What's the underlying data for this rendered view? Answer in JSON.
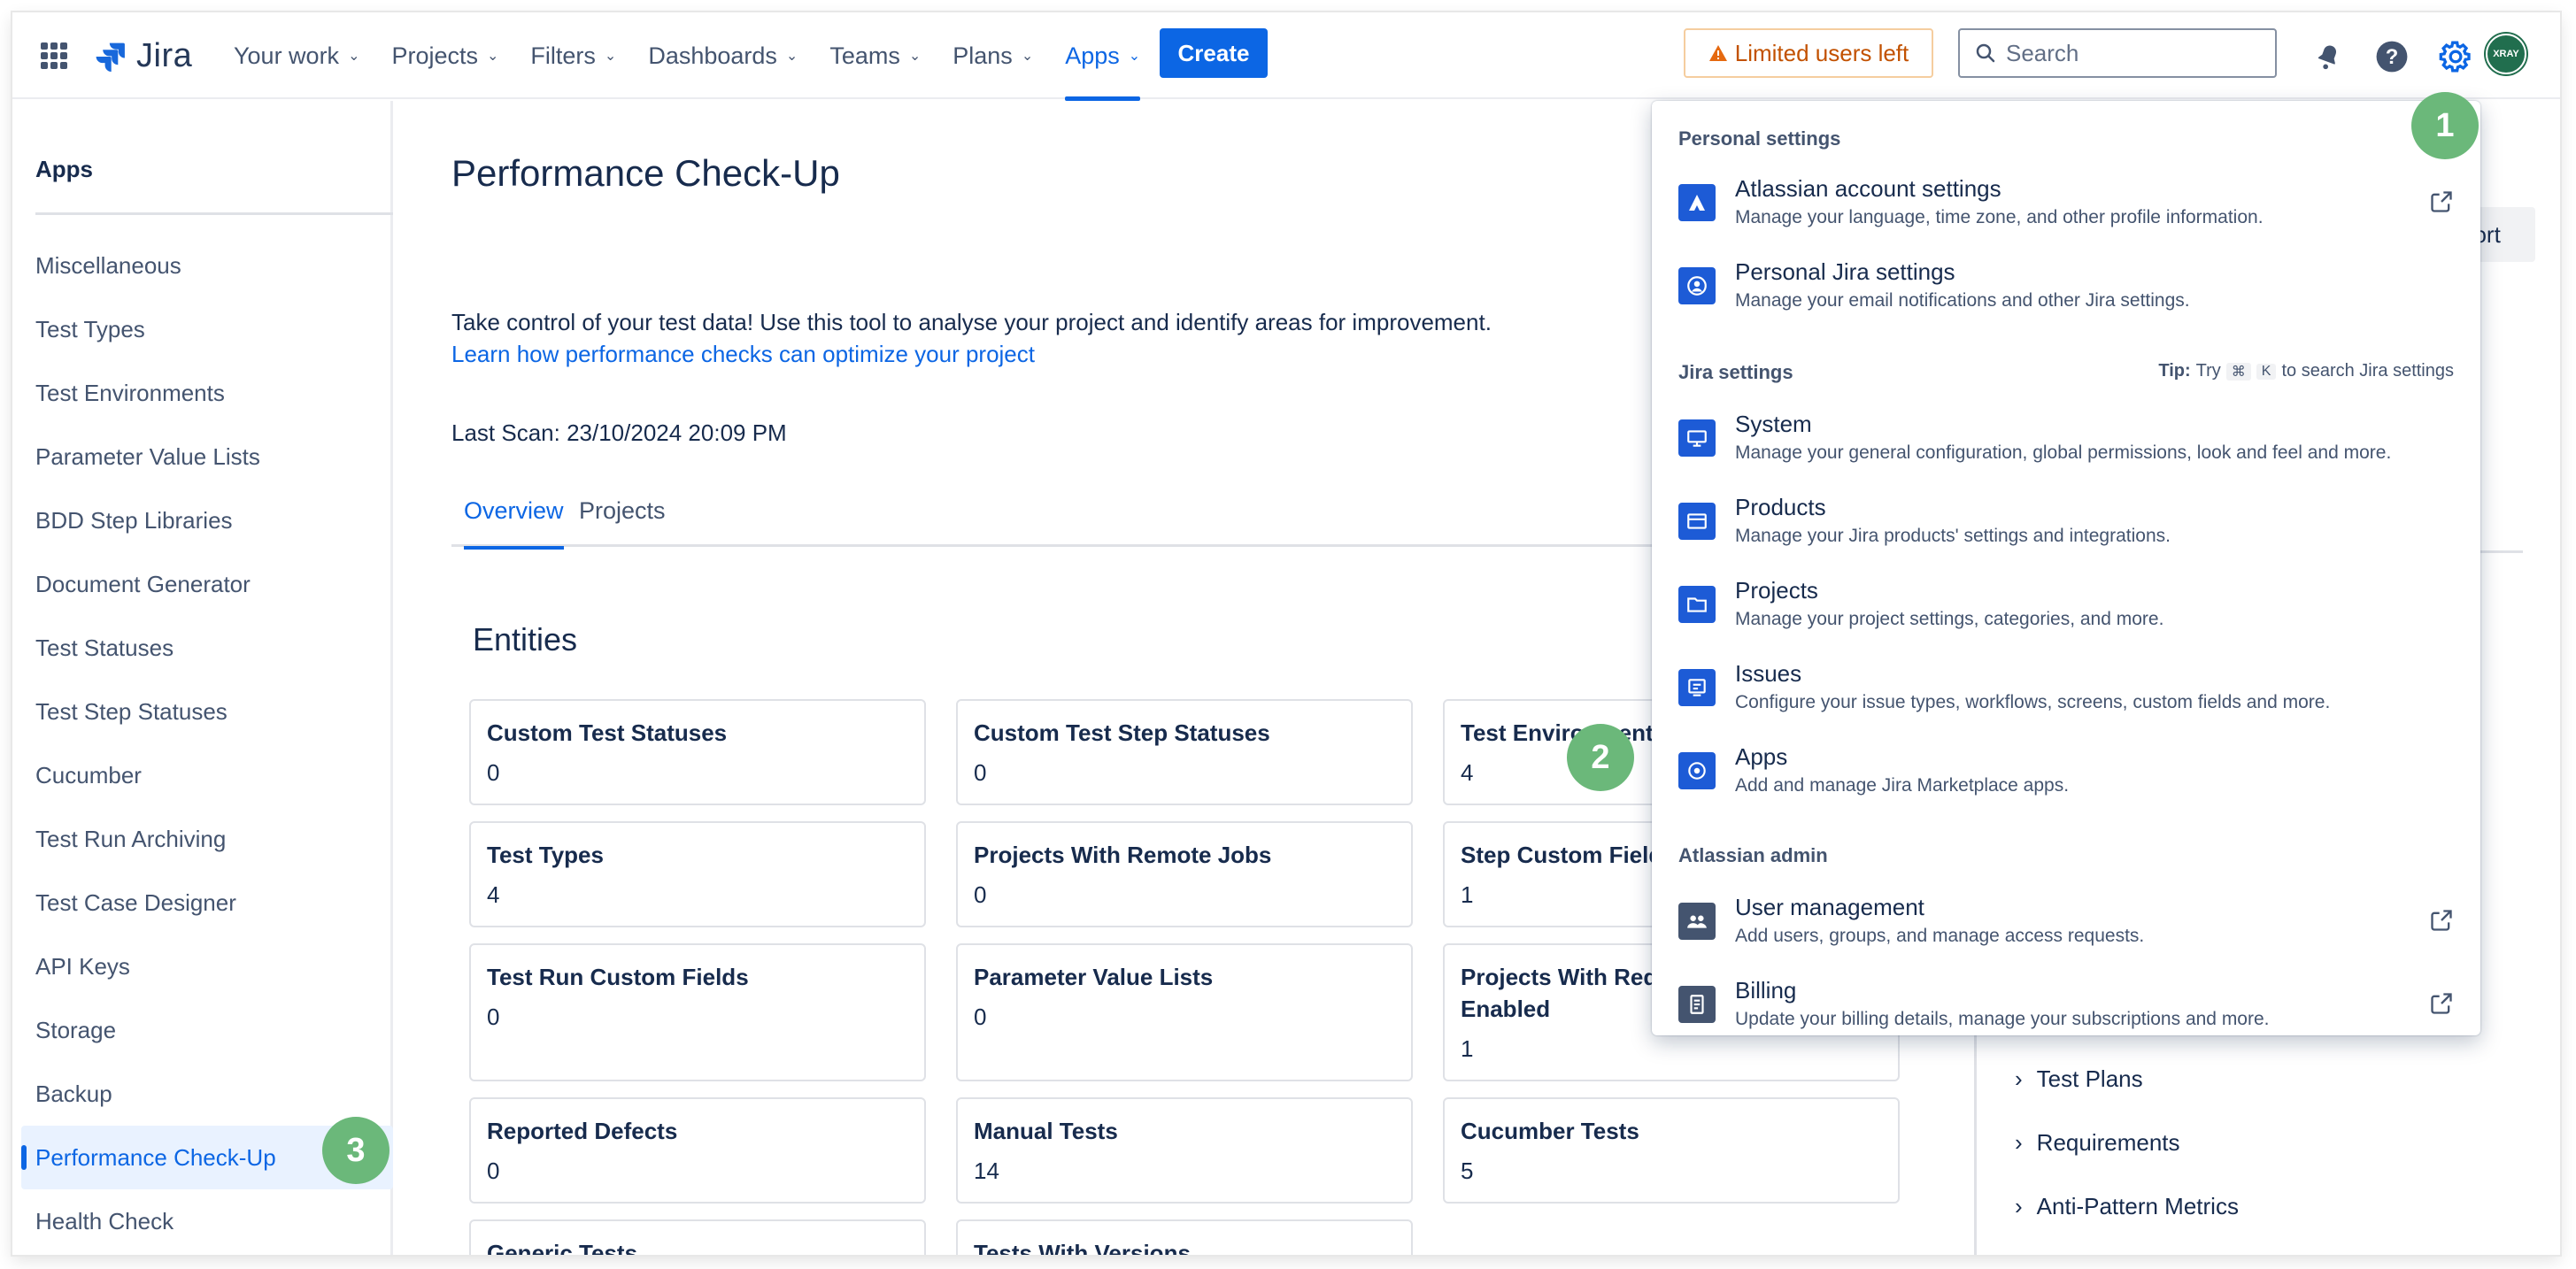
{
  "nav": {
    "logo": "Jira",
    "items": [
      {
        "label": "Your work"
      },
      {
        "label": "Projects"
      },
      {
        "label": "Filters"
      },
      {
        "label": "Dashboards"
      },
      {
        "label": "Teams"
      },
      {
        "label": "Plans"
      },
      {
        "label": "Apps",
        "active": true
      }
    ],
    "create": "Create",
    "limited_users": "Limited users left",
    "search_placeholder": "Search",
    "avatar": "XRAY"
  },
  "sidebar": {
    "title": "Apps",
    "items": [
      {
        "label": "Miscellaneous"
      },
      {
        "label": "Test Types"
      },
      {
        "label": "Test Environments"
      },
      {
        "label": "Parameter Value Lists"
      },
      {
        "label": "BDD Step Libraries"
      },
      {
        "label": "Document Generator"
      },
      {
        "label": "Test Statuses"
      },
      {
        "label": "Test Step Statuses"
      },
      {
        "label": "Cucumber"
      },
      {
        "label": "Test Run Archiving"
      },
      {
        "label": "Test Case Designer"
      },
      {
        "label": "API Keys"
      },
      {
        "label": "Storage"
      },
      {
        "label": "Backup"
      },
      {
        "label": "Performance Check-Up",
        "active": true
      },
      {
        "label": "Health Check"
      }
    ]
  },
  "main": {
    "title": "Performance Check-Up",
    "intro": "Take control of your test data! Use this tool to analyse your project and identify areas for improvement.",
    "learn_link": "Learn how performance checks can optimize your project",
    "last_scan": "Last Scan: 23/10/2024 20:09 PM",
    "tabs": [
      "Overview",
      "Projects"
    ],
    "section": "Entities",
    "cards": [
      {
        "title": "Custom Test Statuses",
        "value": "0"
      },
      {
        "title": "Custom Test Step Statuses",
        "value": "0"
      },
      {
        "title": "Test Environments",
        "value": "4"
      },
      {
        "title": "Test Types",
        "value": "4"
      },
      {
        "title": "Projects With Remote Jobs",
        "value": "0"
      },
      {
        "title": "Step Custom Fields",
        "value": "1"
      },
      {
        "title": "Test Run Custom Fields",
        "value": "0"
      },
      {
        "title": "Parameter Value Lists",
        "value": "0"
      },
      {
        "title": "Projects With Requirement Enabled",
        "value": "1"
      },
      {
        "title": "Reported Defects",
        "value": "0"
      },
      {
        "title": "Manual Tests",
        "value": "14"
      },
      {
        "title": "Cucumber Tests",
        "value": "5"
      },
      {
        "title": "Generic Tests",
        "value": ""
      },
      {
        "title": "Tests With Versions",
        "value": ""
      }
    ],
    "export_label": "port",
    "right_items": [
      "Test Plans",
      "Requirements",
      "Anti-Pattern Metrics"
    ]
  },
  "dropdown": {
    "personal_heading": "Personal settings",
    "jira_heading": "Jira settings",
    "tip_label": "Tip:",
    "tip_pre": "Try",
    "tip_key1": "⌘",
    "tip_key2": "K",
    "tip_post": "to search Jira settings",
    "admin_heading": "Atlassian admin",
    "items": [
      {
        "label": "Atlassian account settings",
        "desc": "Manage your language, time zone, and other profile information."
      },
      {
        "label": "Personal Jira settings",
        "desc": "Manage your email notifications and other Jira settings."
      },
      {
        "label": "System",
        "desc": "Manage your general configuration, global permissions, look and feel and more."
      },
      {
        "label": "Products",
        "desc": "Manage your Jira products' settings and integrations."
      },
      {
        "label": "Projects",
        "desc": "Manage your project settings, categories, and more."
      },
      {
        "label": "Issues",
        "desc": "Configure your issue types, workflows, screens, custom fields and more."
      },
      {
        "label": "Apps",
        "desc": "Add and manage Jira Marketplace apps."
      },
      {
        "label": "User management",
        "desc": "Add users, groups, and manage access requests."
      },
      {
        "label": "Billing",
        "desc": "Update your billing details, manage your subscriptions and more."
      }
    ]
  },
  "callouts": [
    "1",
    "2",
    "3"
  ],
  "colors": {
    "accent": "#0c66e4",
    "callout": "#6bb87a",
    "warning": "#c25100"
  }
}
